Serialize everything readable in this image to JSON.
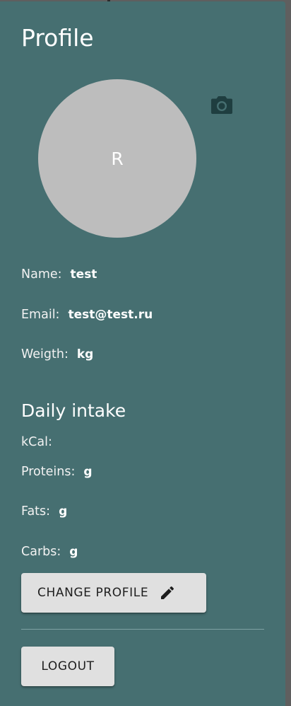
{
  "profile": {
    "title": "Profile",
    "avatar_initial": "R",
    "fields": [
      {
        "label": "Name:",
        "value": "test"
      },
      {
        "label": "Email:",
        "value": "test@test.ru"
      },
      {
        "label": "Weigth:",
        "value": "kg"
      }
    ]
  },
  "daily_intake": {
    "title": "Daily intake",
    "rows": [
      {
        "label": "kCal:",
        "value": ""
      },
      {
        "label": "Proteins:",
        "value": "g"
      },
      {
        "label": "Fats:",
        "value": "g"
      },
      {
        "label": "Carbs:",
        "value": "g"
      }
    ]
  },
  "actions": {
    "change_profile_label": "CHANGE PROFILE",
    "logout_label": "LOGOUT"
  },
  "icons": {
    "camera": "camera-icon",
    "pencil": "pencil-icon"
  },
  "colors": {
    "panel_background": "#466f71",
    "avatar_background": "#bdbdbd",
    "button_background": "#e0e0e0",
    "camera_icon": "#1f3e40"
  }
}
